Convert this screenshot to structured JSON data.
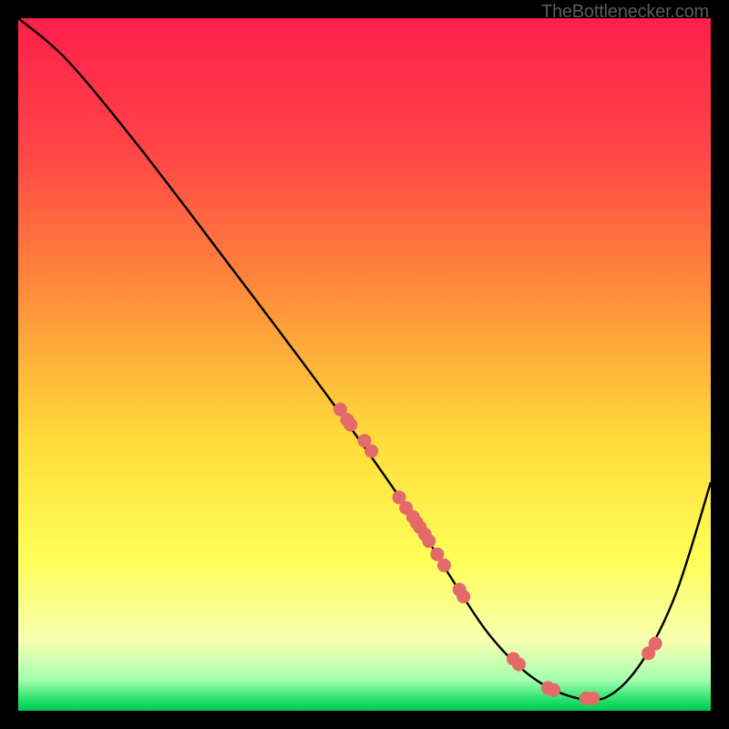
{
  "attribution": "TheBottlenecker.com",
  "chart_data": {
    "type": "line",
    "title": "",
    "xlabel": "",
    "ylabel": "",
    "xlim": [
      0,
      100
    ],
    "ylim": [
      0,
      100
    ],
    "series": [
      {
        "name": "curve",
        "x": [
          0,
          7,
          17,
          30,
          45,
          57,
          62,
          68,
          74,
          80,
          85,
          90,
          95,
          100
        ],
        "y": [
          100,
          94,
          82,
          65,
          45,
          28,
          20,
          11,
          5,
          2,
          2,
          7,
          17,
          33
        ]
      }
    ],
    "points": {
      "name": "markers",
      "x": [
        46.5,
        47.5,
        48,
        50,
        51,
        55,
        56,
        57,
        57.5,
        58,
        58.7,
        59.3,
        60.5,
        61.5,
        63.7,
        64.3,
        71.5,
        72.3,
        76.5,
        77.3,
        82,
        83,
        91,
        92
      ],
      "y": [
        43.5,
        42,
        41.3,
        39,
        37.5,
        30.8,
        29.3,
        28,
        27.2,
        26.5,
        25.5,
        24.5,
        22.6,
        21,
        17.5,
        16.5,
        7.5,
        6.7,
        3.3,
        3,
        1.8,
        1.8,
        8.3,
        9.7
      ]
    },
    "gradient_stops": [
      {
        "offset": 0.0,
        "color": "#ff1f4b"
      },
      {
        "offset": 0.2,
        "color": "#ff4747"
      },
      {
        "offset": 0.4,
        "color": "#ff8e3a"
      },
      {
        "offset": 0.6,
        "color": "#ffd93a"
      },
      {
        "offset": 0.78,
        "color": "#ffff58"
      },
      {
        "offset": 0.9,
        "color": "#f6ffb0"
      },
      {
        "offset": 0.955,
        "color": "#a6ffb0"
      },
      {
        "offset": 0.985,
        "color": "#22e06a"
      },
      {
        "offset": 1.0,
        "color": "#00c752"
      }
    ],
    "marker_color": "#e46a6a",
    "curve_color": "#000000"
  }
}
